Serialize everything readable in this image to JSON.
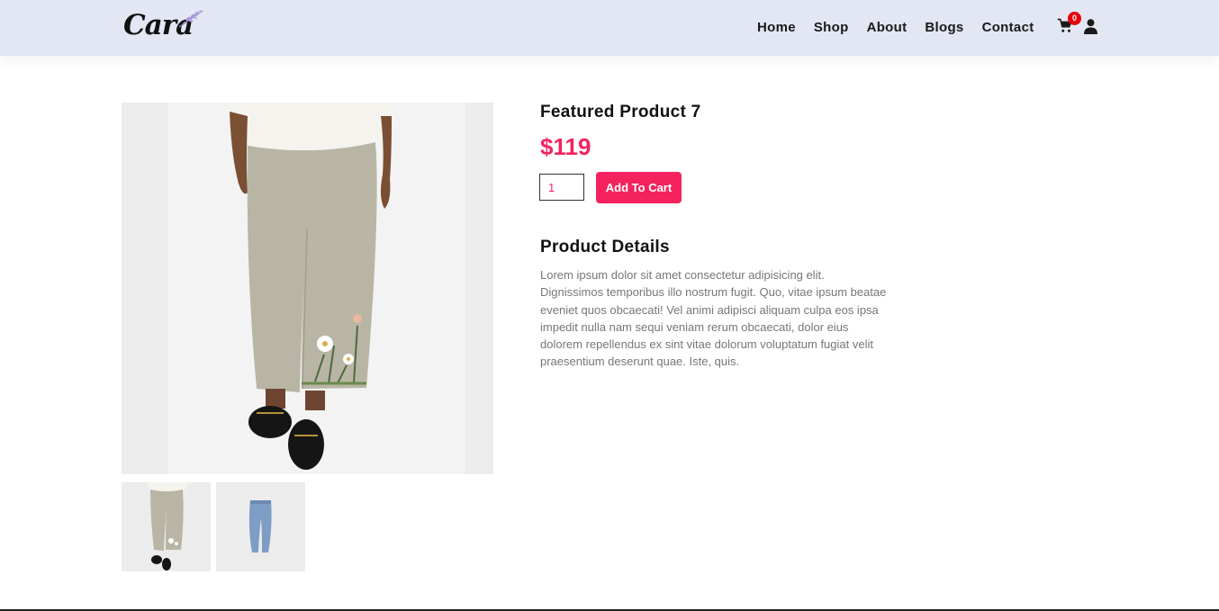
{
  "brand": {
    "logo_text": "Cara"
  },
  "nav": {
    "items": [
      {
        "label": "Home"
      },
      {
        "label": "Shop"
      },
      {
        "label": "About"
      },
      {
        "label": "Blogs"
      },
      {
        "label": "Contact"
      }
    ],
    "cart_count": "0"
  },
  "product": {
    "title": "Featured Product 7",
    "price": "$119",
    "quantity": "1",
    "add_to_cart_label": "Add To Cart",
    "details_heading": "Product Details",
    "details_text": "Lorem ipsum dolor sit amet consectetur adipisicing elit. Dignissimos temporibus illo nostrum fugit. Quo, vitae ipsum beatae eveniet quos obcaecati! Vel animi adipisci aliquam culpa eos ipsa impedit nulla nam sequi veniam rerum obcaecati, dolor eius dolorem repellendus ex sint vitae dolorum voluptatum fugiat velit praesentium deserunt quae. Iste, quis."
  },
  "colors": {
    "header_bg": "#e3e6f3",
    "accent": "#f4235f",
    "badge": "#e8000b"
  },
  "icons": [
    "cart-icon",
    "user-icon"
  ]
}
